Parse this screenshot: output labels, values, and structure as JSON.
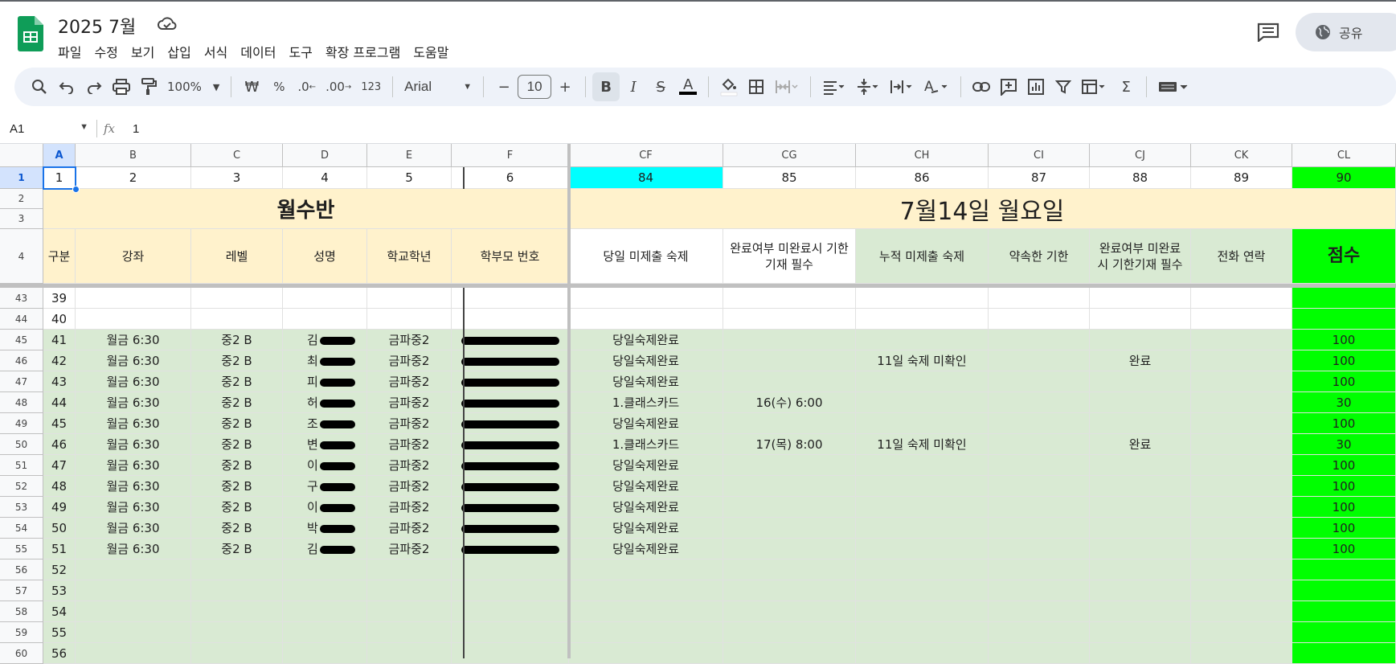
{
  "app": {
    "title": "2025 7월",
    "menu": [
      "파일",
      "수정",
      "보기",
      "삽입",
      "서식",
      "데이터",
      "도구",
      "확장 프로그램",
      "도움말"
    ],
    "share_label": "공유",
    "icons": [
      "sheets-logo-icon",
      "cloud-saved-icon",
      "comment-icon",
      "globe-icon"
    ]
  },
  "toolbar": {
    "zoom": "100%",
    "currency": "₩",
    "percent": "%",
    "dec_less": ".0",
    "dec_more": ".00",
    "number_format": "123",
    "font": "Arial",
    "font_size": "10"
  },
  "formula_bar": {
    "name_box": "A1",
    "fx": "fx",
    "value": "1"
  },
  "columns": {
    "left": [
      "A",
      "B",
      "C",
      "D",
      "E",
      "F"
    ],
    "right": [
      "CF",
      "CG",
      "CH",
      "CI",
      "CJ",
      "CK",
      "CL"
    ]
  },
  "row1": {
    "left": [
      "1",
      "2",
      "3",
      "4",
      "5",
      "6"
    ],
    "right": [
      "84",
      "85",
      "86",
      "87",
      "88",
      "89",
      "90"
    ]
  },
  "rows_2_3": {
    "left_title": "월수반",
    "right_title": "7월14일 월요일"
  },
  "header_row": {
    "left": [
      "구분",
      "강좌",
      "레벨",
      "성명",
      "학교학년",
      "학부모 번호"
    ],
    "right": [
      "당일 미제출 숙제",
      "완료여부      미완료시 기한기재 필수",
      "누적 미제출 숙제",
      "약속한 기한",
      "완료여부 미완료시 기한기재 필수",
      "전화 연락",
      "점수"
    ]
  },
  "colors": {
    "cream": "#fff2cc",
    "green": "#d9ead3",
    "lime": "#00ff00",
    "cyan": "#00ffff",
    "accent": "#1a73e8"
  },
  "data_rows": [
    {
      "row": "43",
      "a": "39",
      "b": "",
      "c": "",
      "d": "",
      "e": "",
      "cf": "",
      "cg": "",
      "ch": "",
      "ci": "",
      "cj": "",
      "ck": "",
      "cl": "",
      "filled": false
    },
    {
      "row": "44",
      "a": "40",
      "b": "",
      "c": "",
      "d": "",
      "e": "",
      "cf": "",
      "cg": "",
      "ch": "",
      "ci": "",
      "cj": "",
      "ck": "",
      "cl": "",
      "filled": false
    },
    {
      "row": "45",
      "a": "41",
      "b": "월금 6:30",
      "c": "중2 B",
      "d": "김",
      "e": "금파중2",
      "cf": "당일숙제완료",
      "cg": "",
      "ch": "",
      "ci": "",
      "cj": "",
      "ck": "",
      "cl": "100",
      "filled": true
    },
    {
      "row": "46",
      "a": "42",
      "b": "월금 6:30",
      "c": "중2 B",
      "d": "최",
      "e": "금파중2",
      "cf": "당일숙제완료",
      "cg": "",
      "ch": "11일 숙제 미확인",
      "ci": "",
      "cj": "완료",
      "ck": "",
      "cl": "100",
      "filled": true
    },
    {
      "row": "47",
      "a": "43",
      "b": "월금 6:30",
      "c": "중2 B",
      "d": "피",
      "e": "금파중2",
      "cf": "당일숙제완료",
      "cg": "",
      "ch": "",
      "ci": "",
      "cj": "",
      "ck": "",
      "cl": "100",
      "filled": true
    },
    {
      "row": "48",
      "a": "44",
      "b": "월금 6:30",
      "c": "중2 B",
      "d": "허",
      "e": "금파중2",
      "cf": "1.클래스카드",
      "cg": "16(수) 6:00",
      "ch": "",
      "ci": "",
      "cj": "",
      "ck": "",
      "cl": "30",
      "filled": true
    },
    {
      "row": "49",
      "a": "45",
      "b": "월금 6:30",
      "c": "중2 B",
      "d": "조",
      "e": "금파중2",
      "cf": "당일숙제완료",
      "cg": "",
      "ch": "",
      "ci": "",
      "cj": "",
      "ck": "",
      "cl": "100",
      "filled": true
    },
    {
      "row": "50",
      "a": "46",
      "b": "월금 6:30",
      "c": "중2 B",
      "d": "변",
      "e": "금파중2",
      "cf": "1.클래스카드",
      "cg": "17(목) 8:00",
      "ch": "11일 숙제 미확인",
      "ci": "",
      "cj": "완료",
      "ck": "",
      "cl": "30",
      "filled": true
    },
    {
      "row": "51",
      "a": "47",
      "b": "월금 6:30",
      "c": "중2 B",
      "d": "이",
      "e": "금파중2",
      "cf": "당일숙제완료",
      "cg": "",
      "ch": "",
      "ci": "",
      "cj": "",
      "ck": "",
      "cl": "100",
      "filled": true
    },
    {
      "row": "52",
      "a": "48",
      "b": "월금 6:30",
      "c": "중2 B",
      "d": "구",
      "e": "금파중2",
      "cf": "당일숙제완료",
      "cg": "",
      "ch": "",
      "ci": "",
      "cj": "",
      "ck": "",
      "cl": "100",
      "filled": true
    },
    {
      "row": "53",
      "a": "49",
      "b": "월금 6:30",
      "c": "중2 B",
      "d": "이",
      "e": "금파중2",
      "cf": "당일숙제완료",
      "cg": "",
      "ch": "",
      "ci": "",
      "cj": "",
      "ck": "",
      "cl": "100",
      "filled": true
    },
    {
      "row": "54",
      "a": "50",
      "b": "월금 6:30",
      "c": "중2 B",
      "d": "박",
      "e": "금파중2",
      "cf": "당일숙제완료",
      "cg": "",
      "ch": "",
      "ci": "",
      "cj": "",
      "ck": "",
      "cl": "100",
      "filled": true
    },
    {
      "row": "55",
      "a": "51",
      "b": "월금 6:30",
      "c": "중2 B",
      "d": "김",
      "e": "금파중2",
      "cf": "당일숙제완료",
      "cg": "",
      "ch": "",
      "ci": "",
      "cj": "",
      "ck": "",
      "cl": "100",
      "filled": true
    },
    {
      "row": "56",
      "a": "52",
      "b": "",
      "c": "",
      "d": "",
      "e": "",
      "cf": "",
      "cg": "",
      "ch": "",
      "ci": "",
      "cj": "",
      "ck": "",
      "cl": "",
      "filled": true
    },
    {
      "row": "57",
      "a": "53",
      "b": "",
      "c": "",
      "d": "",
      "e": "",
      "cf": "",
      "cg": "",
      "ch": "",
      "ci": "",
      "cj": "",
      "ck": "",
      "cl": "",
      "filled": true
    },
    {
      "row": "58",
      "a": "54",
      "b": "",
      "c": "",
      "d": "",
      "e": "",
      "cf": "",
      "cg": "",
      "ch": "",
      "ci": "",
      "cj": "",
      "ck": "",
      "cl": "",
      "filled": true
    },
    {
      "row": "59",
      "a": "55",
      "b": "",
      "c": "",
      "d": "",
      "e": "",
      "cf": "",
      "cg": "",
      "ch": "",
      "ci": "",
      "cj": "",
      "ck": "",
      "cl": "",
      "filled": true
    },
    {
      "row": "60",
      "a": "56",
      "b": "",
      "c": "",
      "d": "",
      "e": "",
      "cf": "",
      "cg": "",
      "ch": "",
      "ci": "",
      "cj": "",
      "ck": "",
      "cl": "",
      "filled": true
    }
  ]
}
